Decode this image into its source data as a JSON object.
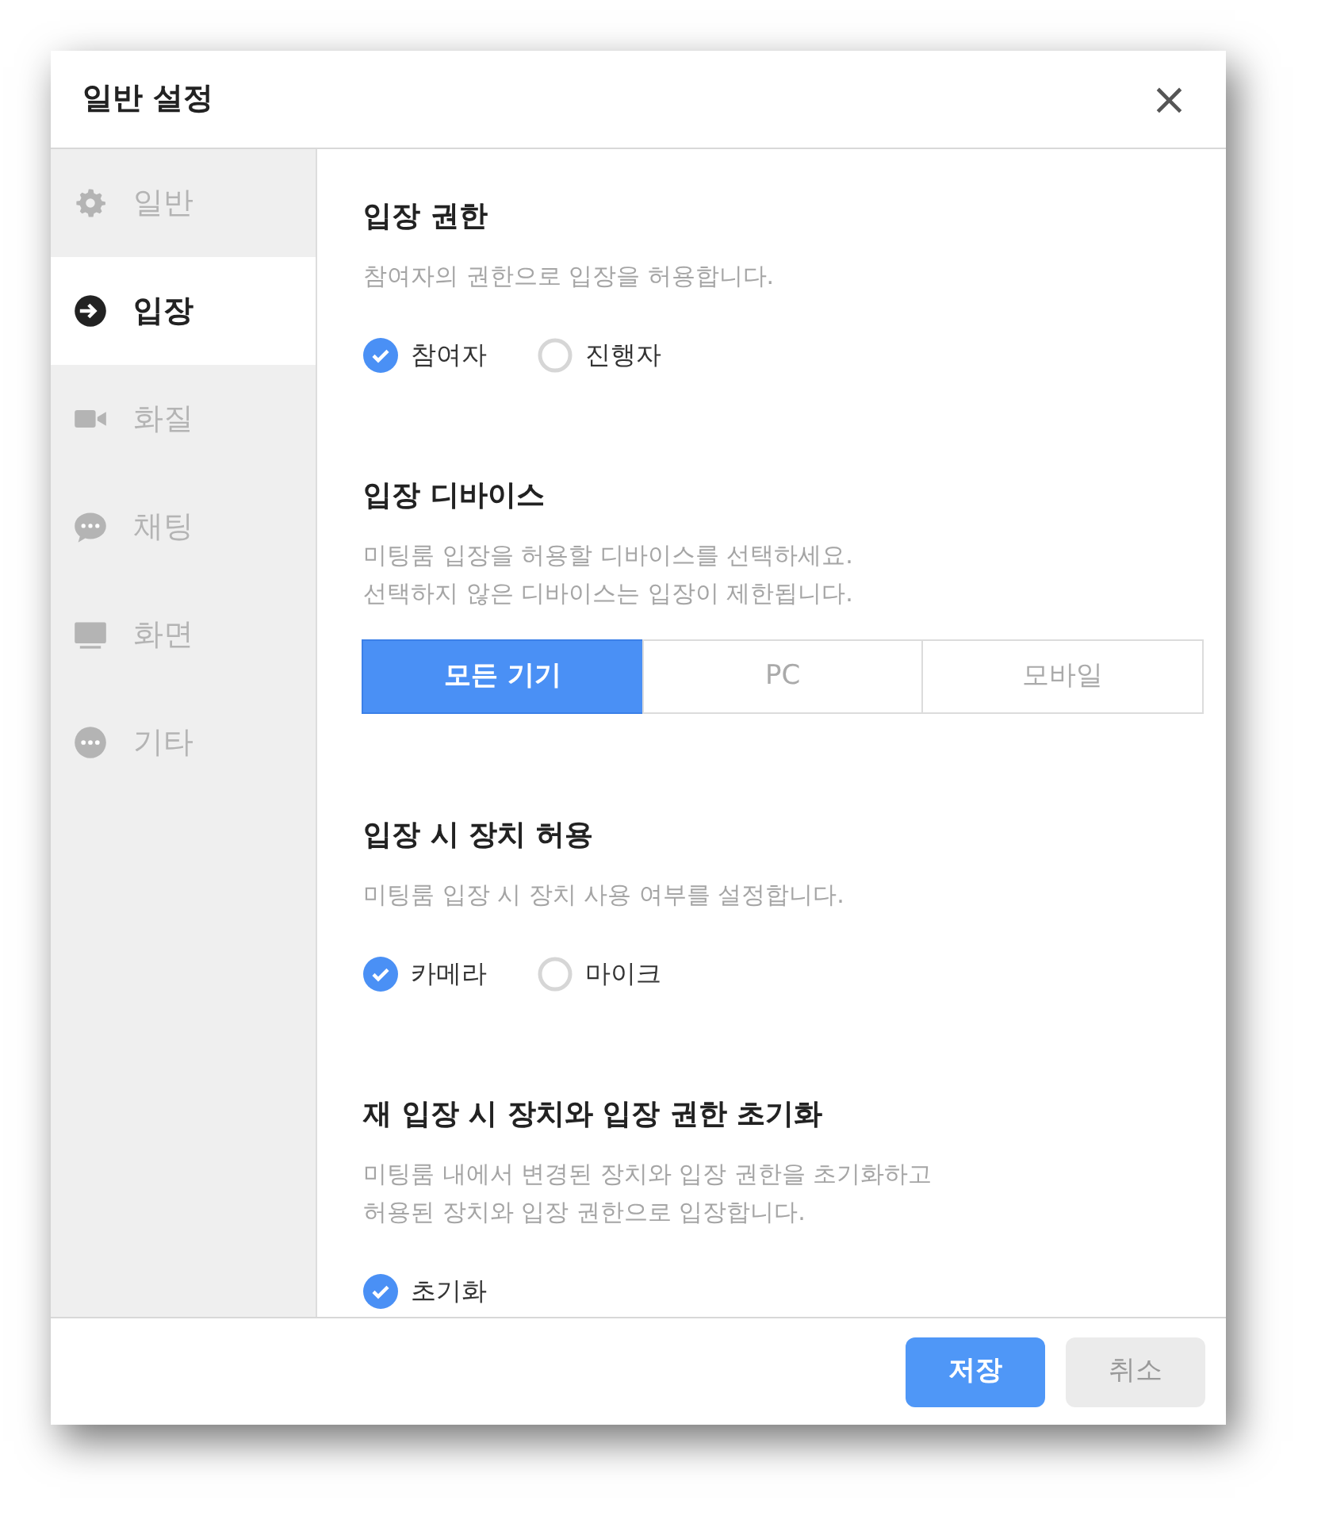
{
  "dialog": {
    "title": "일반 설정",
    "close": "×"
  },
  "sidebar": {
    "items": [
      {
        "label": "일반",
        "selected": false
      },
      {
        "label": "입장",
        "selected": true
      },
      {
        "label": "화질",
        "selected": false
      },
      {
        "label": "채팅",
        "selected": false
      },
      {
        "label": "화면",
        "selected": false
      },
      {
        "label": "기타",
        "selected": false
      }
    ]
  },
  "sections": [
    {
      "kind": "options",
      "title": "입장 권한",
      "description": [
        "참여자의 권한으로 입장을 허용합니다."
      ],
      "options": [
        {
          "label": "참여자",
          "checked": true
        },
        {
          "label": "진행자",
          "checked": false
        }
      ]
    },
    {
      "kind": "segmented",
      "title": "입장 디바이스",
      "description": [
        "미팅룸 입장을 허용할 디바이스를 선택하세요.",
        "선택하지 않은 디바이스는 입장이 제한됩니다."
      ],
      "options": [
        {
          "label": "모든 기기",
          "selected": true
        },
        {
          "label": "PC",
          "selected": false
        },
        {
          "label": "모바일",
          "selected": false
        }
      ]
    },
    {
      "kind": "options",
      "title": "입장 시 장치 허용",
      "description": [
        "미팅룸 입장 시 장치 사용 여부를 설정합니다."
      ],
      "options": [
        {
          "label": "카메라",
          "checked": true
        },
        {
          "label": "마이크",
          "checked": false
        }
      ]
    },
    {
      "kind": "options",
      "title": "재 입장 시 장치와 입장 권한 초기화",
      "description": [
        "미팅룸 내에서 변경된 장치와 입장 권한을 초기화하고",
        "허용된 장치와 입장 권한으로 입장합니다."
      ],
      "options": [
        {
          "label": "초기화",
          "checked": true
        }
      ]
    }
  ],
  "footer": {
    "buttons": [
      {
        "label": "저장",
        "kind": "primary"
      },
      {
        "label": "취소",
        "kind": "secondary"
      }
    ]
  }
}
